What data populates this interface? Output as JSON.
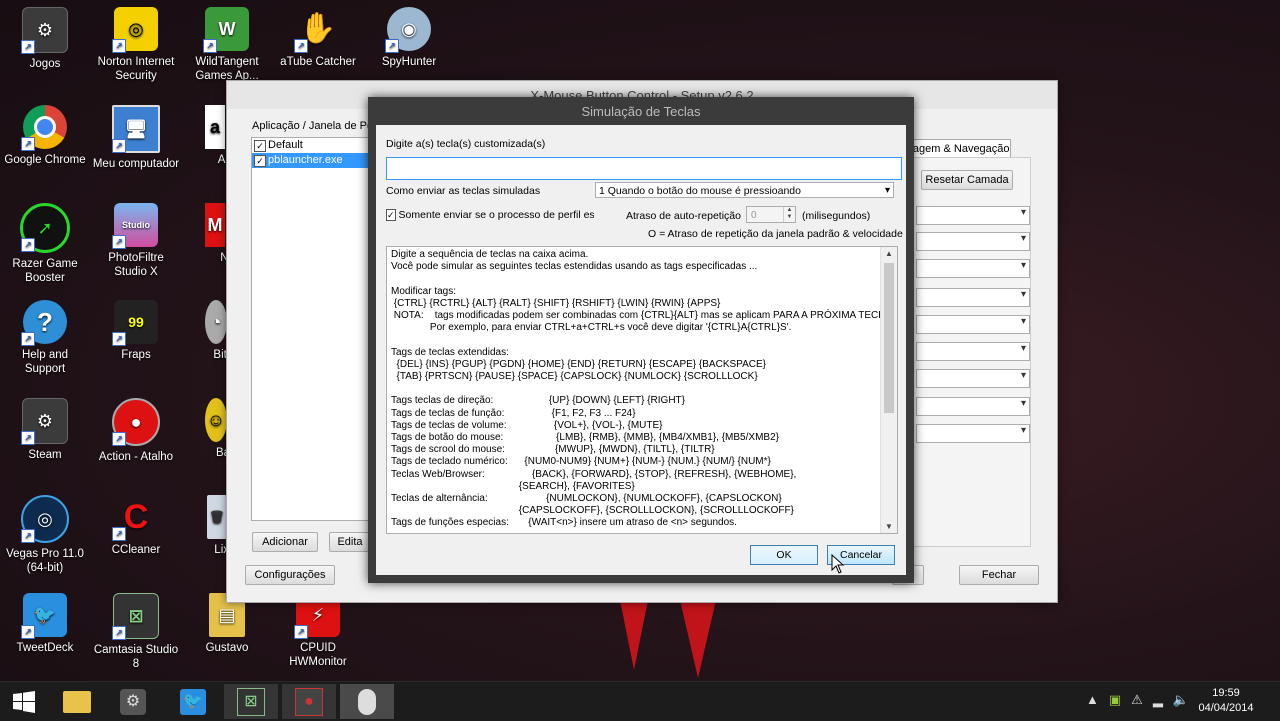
{
  "desktop": {
    "icons": [
      {
        "label": "Jogos"
      },
      {
        "label": "Norton Internet Security"
      },
      {
        "label": "WildTangent Games Ap..."
      },
      {
        "label": "aTube Catcher"
      },
      {
        "label": "SpyHunter"
      },
      {
        "label": "Google Chrome"
      },
      {
        "label": "Meu computador"
      },
      {
        "label": "Am"
      },
      {
        "label": "Razer Game Booster"
      },
      {
        "label": "PhotoFiltre Studio X"
      },
      {
        "label": "Ne"
      },
      {
        "label": "Help and Support"
      },
      {
        "label": "Fraps"
      },
      {
        "label": "BitTo"
      },
      {
        "label": "Steam"
      },
      {
        "label": "Action - Atalho"
      },
      {
        "label": "Bala"
      },
      {
        "label": "Vegas Pro 11.0 (64-bit)"
      },
      {
        "label": "CCleaner"
      },
      {
        "label": "Lix"
      },
      {
        "label": "TweetDeck"
      },
      {
        "label": "Camtasia Studio 8"
      },
      {
        "label": "Gustavo"
      },
      {
        "label": "CPUID HWMonitor"
      }
    ]
  },
  "main_window": {
    "title": "X-Mouse Button Control - Setup v2.6.2",
    "profiles_label": "Aplicação / Janela de Perf",
    "profiles": [
      {
        "name": "Default",
        "checked": true
      },
      {
        "name": "pblauncher.exe",
        "checked": true
      }
    ],
    "tab": "lagem & Navegação",
    "reset_layer_button": "Resetar Camada",
    "add_button": "Adicionar",
    "edit_button": "Edita",
    "settings_button": "Configurações",
    "apply_button": "ar",
    "close_button": "Fechar"
  },
  "dialog": {
    "title": "Simulação de Teclas",
    "custom_keys_label": "Digite a(s) tecla(s) customizada(s)",
    "custom_keys_value": "",
    "send_mode_label": "Como enviar as teclas simuladas",
    "send_mode_value": "1 Quando o botão do mouse é pressioando",
    "only_profile_label": "Somente enviar se o processo de perfil está",
    "only_profile_checked": true,
    "repeat_delay_label": "Atraso de auto-repetição",
    "repeat_delay_value": "0",
    "repeat_delay_unit": "(milisegundos)",
    "repeat_note": "O = Atraso de repetição da janela padrão & velocidade",
    "help_lines": [
      "Digite a sequência de teclas na caixa acima.",
      "Você pode simular as seguintes teclas estendidas usando as tags especificadas ...",
      "",
      "Modificar tags:",
      " {CTRL} {RCTRL} {ALT} {RALT} {SHIFT} {RSHIFT} {LWIN} {RWIN} {APPS}",
      " NOTA:    tags modificadas podem ser combinadas com {CTRL}{ALT} mas se aplicam PARA A PRÓXIMA TECL",
      "              Por exemplo, para enviar CTRL+a+CTRL+s você deve digitar '{CTRL}A{CTRL}S'.",
      "",
      "Tags de teclas extendidas:",
      "  {DEL} {INS} {PGUP} {PGDN} {HOME} {END} {RETURN} {ESCAPE} {BACKSPACE}",
      "  {TAB} {PRTSCN} {PAUSE} {SPACE} {CAPSLOCK} {NUMLOCK} {SCROLLLOCK}",
      "",
      "Tags teclas de direção:                    {UP} {DOWN} {LEFT} {RIGHT}",
      "Tags de teclas de função:                 {F1, F2, F3 ... F24}",
      "Tags de teclas de volume:                 {VOL+}, {VOL-}, {MUTE}",
      "Tags de botão do mouse:                   {LMB}, {RMB}, {MMB}, {MB4/XMB1}, {MB5/XMB2}",
      "Tags de scrool do mouse:                  {MWUP}, {MWDN}, {TILTL}, {TILTR}",
      "Tags de teclado numérico:      {NUM0-NUM9} {NUM+} {NUM-} {NUM.} {NUM/} {NUM*}",
      "Teclas Web/Browser:                 {BACK}, {FORWARD}, {STOP}, {REFRESH}, {WEBHOME},",
      "                                              {SEARCH}, {FAVORITES}",
      "Teclas de alternância:                     {NUMLOCKON}, {NUMLOCKOFF}, {CAPSLOCKON}",
      "                                              {CAPSLOCKOFF}, {SCROLLLOCKON}, {SCROLLLOCKOFF}",
      "Tags de funções especias:       {WAIT<n>} insere um atraso de <n> segundos."
    ],
    "ok_button": "OK",
    "cancel_button": "Cancelar"
  },
  "taskbar": {
    "time": "19:59",
    "date": "04/04/2014"
  }
}
